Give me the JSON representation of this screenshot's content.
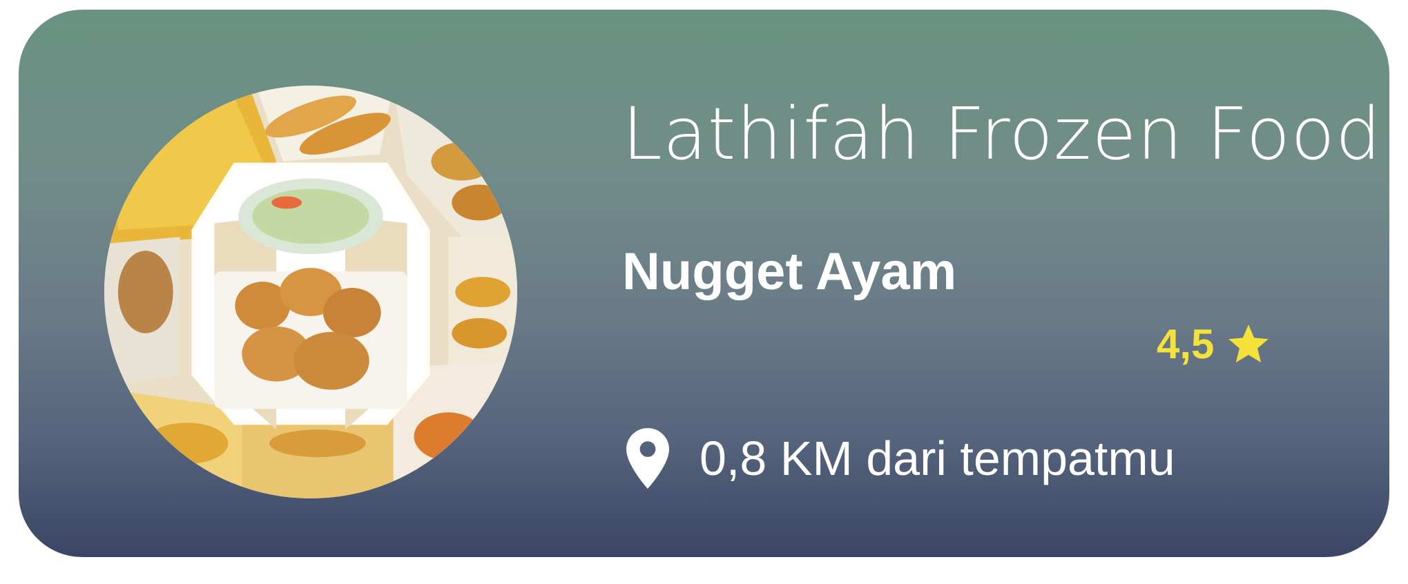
{
  "card": {
    "store_name": "Lathifah Frozen Food",
    "product_name": "Nugget Ayam",
    "rating": "4,5",
    "rating_icon": "star-icon",
    "location_icon": "map-pin-icon",
    "distance": "0,8 KM dari tempatmu",
    "image_icon": "food-photo"
  },
  "colors": {
    "gradient_top": "#6a9282",
    "gradient_bottom": "#3a4664",
    "rating": "#f2e23a",
    "text": "#ffffff"
  }
}
